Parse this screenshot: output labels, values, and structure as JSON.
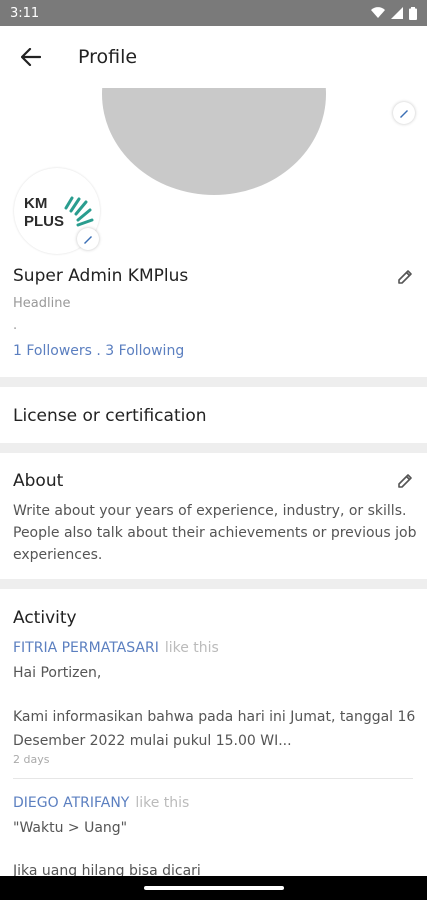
{
  "status": {
    "time": "3:11"
  },
  "app_bar": {
    "title": "Profile"
  },
  "profile": {
    "logo_line1": "KM",
    "logo_line2": "PLUS",
    "name": "Super Admin KMPlus",
    "headline": "Headline",
    "dot": ".",
    "follow_text": "1 Followers . 3 Following"
  },
  "sections": {
    "license_title": "License or certification",
    "about_title": "About",
    "about_text": "Write about your years of experience, industry, or skills. People also talk about their achievements or previous job experiences.",
    "activity_title": "Activity"
  },
  "activity": [
    {
      "name": "FITRIA PERMATASARI",
      "like": "like this",
      "line1": "Hai Portizen,",
      "line2": "Kami informasikan bahwa pada hari ini Jumat, tanggal 16 Desember 2022 mulai pukul 15.00 WI...",
      "time": "2 days"
    },
    {
      "name": "DIEGO ATRIFANY",
      "like": "like this",
      "line1": "\"Waktu > Uang\"",
      "line2": "Jika uang hilang bisa dicari"
    }
  ],
  "colors": {
    "link": "#5b7fc0",
    "accent": "#2a9d8f",
    "cover": "#c9c9c9"
  }
}
